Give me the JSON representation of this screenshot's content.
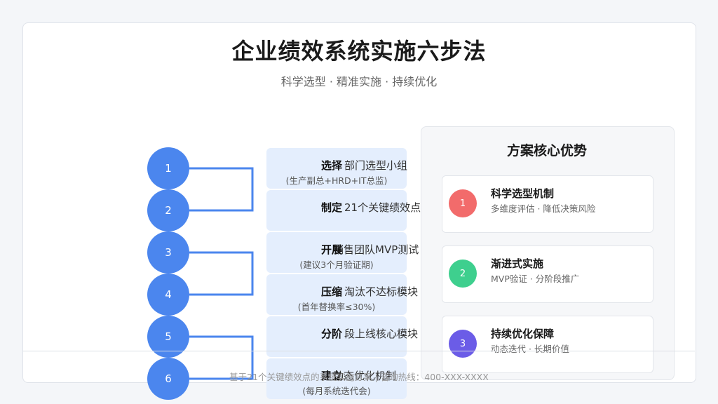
{
  "header": {
    "title": "企业绩效系统实施六步法",
    "subtitle": "科学选型 · 精准实施 · 持续优化"
  },
  "steps": [
    {
      "num": "1",
      "keyword": "选择",
      "desc": "部门选型小组",
      "note": "(生产副总+HRD+IT总监)"
    },
    {
      "num": "2",
      "keyword": "制定",
      "desc": "21个关键绩效点",
      "note": ""
    },
    {
      "num": "3",
      "keyword": "开展",
      "desc": "销售团队MVP测试",
      "note": "(建议3个月验证期)"
    },
    {
      "num": "4",
      "keyword": "压缩",
      "desc": "淘汰不达标模块",
      "note": "(首年替换率≤30%)"
    },
    {
      "num": "5",
      "keyword": "分阶",
      "desc": "段上线核心模块",
      "note": ""
    },
    {
      "num": "6",
      "keyword": "建立",
      "desc": "动态优化机制",
      "note": "(每月系统迭代会)"
    }
  ],
  "advantages": {
    "title": "方案核心优势",
    "items": [
      {
        "num": "1",
        "title": "科学选型机制",
        "desc": "多维度评估 · 降低决策风险",
        "color": "#f26b6b"
      },
      {
        "num": "2",
        "title": "渐进式实施",
        "desc": "MVP验证 · 分阶段推广",
        "color": "#3ecf8e"
      },
      {
        "num": "3",
        "title": "持续优化保障",
        "desc": "动态迭代 · 长期价值",
        "color": "#6b5ce7"
      }
    ]
  },
  "colors": {
    "step_circle": "#4b86ee",
    "connector": "#4b86ee",
    "step_box": "#e4eefd"
  },
  "footer": {
    "text": "基于21个关键绩效点的系统实施方案 | 咨询热线：400-XXX-XXXX"
  }
}
